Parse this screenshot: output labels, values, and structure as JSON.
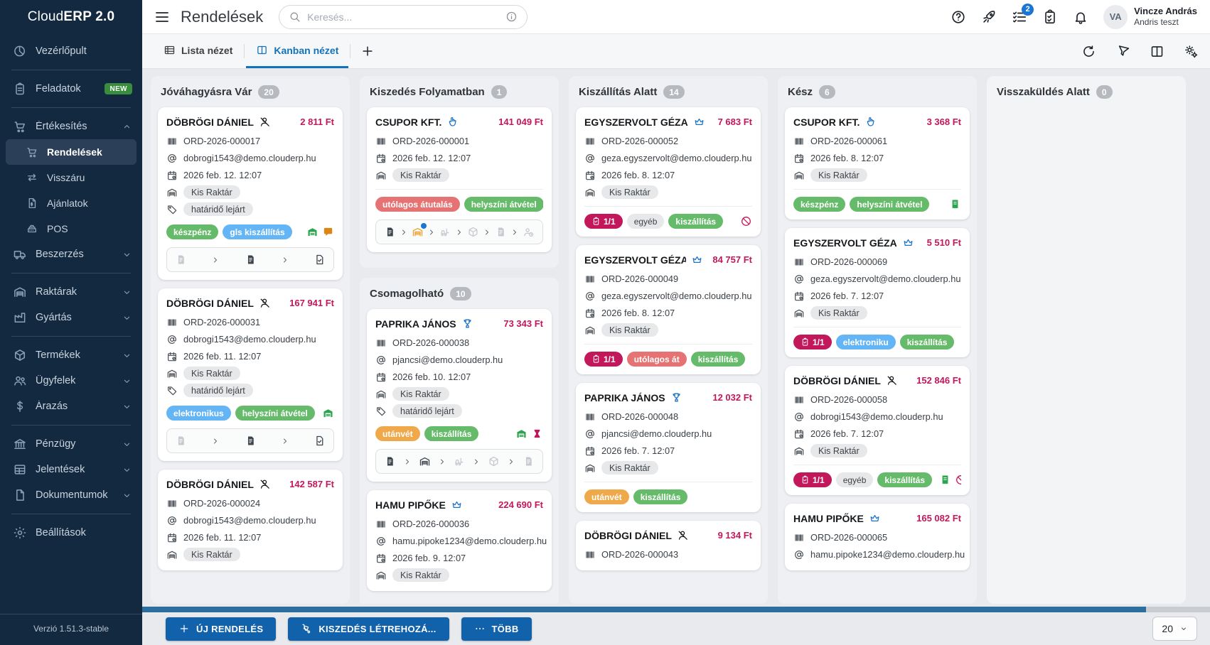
{
  "app": {
    "brand_light": "Cloud",
    "brand_bold": "ERP 2.0",
    "version": "Verzió 1.51.3-stable"
  },
  "sidebar": {
    "items": [
      {
        "type": "item",
        "icon": "dashboard",
        "label": "Vezérlőpult"
      },
      {
        "type": "divider"
      },
      {
        "type": "item",
        "icon": "tasks",
        "label": "Feladatok",
        "badge": "NEW"
      },
      {
        "type": "divider"
      },
      {
        "type": "item",
        "icon": "cart",
        "label": "Értékesítés",
        "chevron": "up"
      },
      {
        "type": "subitem",
        "icon": "cart",
        "label": "Rendelések",
        "active": true
      },
      {
        "type": "subitem",
        "icon": "swap",
        "label": "Visszáru"
      },
      {
        "type": "subitem",
        "icon": "quote",
        "label": "Ajánlatok"
      },
      {
        "type": "subitem",
        "icon": "register",
        "label": "POS"
      },
      {
        "type": "item",
        "icon": "truck",
        "label": "Beszerzés",
        "chevron": "down"
      },
      {
        "type": "divider"
      },
      {
        "type": "item",
        "icon": "warehouse",
        "label": "Raktárak",
        "chevron": "down"
      },
      {
        "type": "item",
        "icon": "factory",
        "label": "Gyártás",
        "chevron": "down"
      },
      {
        "type": "divider"
      },
      {
        "type": "item",
        "icon": "products",
        "label": "Termékek",
        "chevron": "down"
      },
      {
        "type": "item",
        "icon": "customers",
        "label": "Ügyfelek",
        "chevron": "down"
      },
      {
        "type": "item",
        "icon": "pricing",
        "label": "Árazás",
        "chevron": "down"
      },
      {
        "type": "divider"
      },
      {
        "type": "item",
        "icon": "finance",
        "label": "Pénzügy",
        "chevron": "down"
      },
      {
        "type": "item",
        "icon": "reports",
        "label": "Jelentések",
        "chevron": "down"
      },
      {
        "type": "item",
        "icon": "documents",
        "label": "Dokumentumok",
        "chevron": "down"
      },
      {
        "type": "divider"
      },
      {
        "type": "item",
        "icon": "settings",
        "label": "Beállítások"
      }
    ]
  },
  "header": {
    "title": "Rendelések",
    "search_placeholder": "Keresés...",
    "notification_count": "2",
    "user": {
      "initials": "VA",
      "name": "Vincze András",
      "subtitle": "Andris teszt"
    }
  },
  "tabs": {
    "list_label": "Lista nézet",
    "kanban_label": "Kanban nézet"
  },
  "board": {
    "tracks": [
      {
        "fill": true,
        "groups": [
          {
            "title": "Jóváhagyásra Vár",
            "count": "20",
            "cards": [
              {
                "customer": "DÖBRÖGI DÁNIEL",
                "icon": "person-off",
                "icon_color": "dark",
                "price": "2 811 Ft",
                "order": "ORD-2026-000017",
                "email": "dobrogi1543@demo.clouderp.hu",
                "date": "2026 feb. 12. 12:07",
                "warehouse": "Kis Raktár",
                "tag": "határidő lejárt",
                "chips": [
                  {
                    "label": "készpénz",
                    "style": "green"
                  },
                  {
                    "label": "gls kiszállítás",
                    "style": "blue"
                  }
                ],
                "trail": [
                  "warehouse-filled",
                  "chat"
                ],
                "progress": [
                  {
                    "icon": "note",
                    "state": "muted"
                  },
                  {
                    "icon": "note",
                    "state": "dark"
                  },
                  {
                    "icon": "file-check",
                    "state": "dark"
                  }
                ]
              },
              {
                "customer": "DÖBRÖGI DÁNIEL",
                "icon": "person-off",
                "icon_color": "dark",
                "price": "167 941 Ft",
                "order": "ORD-2026-000031",
                "email": "dobrogi1543@demo.clouderp.hu",
                "date": "2026 feb. 11. 12:07",
                "warehouse": "Kis Raktár",
                "tag": "határidő lejárt",
                "chips": [
                  {
                    "label": "elektronikus",
                    "style": "blue"
                  },
                  {
                    "label": "helyszíni átvétel",
                    "style": "green"
                  }
                ],
                "trail": [
                  "warehouse-filled"
                ],
                "progress": [
                  {
                    "icon": "note",
                    "state": "muted"
                  },
                  {
                    "icon": "note",
                    "state": "dark"
                  },
                  {
                    "icon": "file-check",
                    "state": "dark"
                  }
                ]
              },
              {
                "customer": "DÖBRÖGI DÁNIEL",
                "icon": "person-off",
                "icon_color": "dark",
                "price": "142 587 Ft",
                "order": "ORD-2026-000024",
                "email": "dobrogi1543@demo.clouderp.hu",
                "date": "2026 feb. 11. 12:07",
                "warehouse": "Kis Raktár"
              }
            ]
          }
        ]
      },
      {
        "fill": false,
        "groups": [
          {
            "title": "Kiszedés Folyamatban",
            "count": "1",
            "cards": [
              {
                "customer": "CSUPOR KFT.",
                "icon": "pointer",
                "icon_color": "blue",
                "price": "141 049 Ft",
                "order": "ORD-2026-000001",
                "date": "2026 feb. 12. 12:07",
                "warehouse": "Kis Raktár",
                "divider": true,
                "chips": [
                  {
                    "label": "utólagos átutalás",
                    "style": "red"
                  },
                  {
                    "label": "helyszíni átvétel",
                    "style": "green"
                  }
                ],
                "trail": [
                  "warehouse-filled",
                  "hourglass"
                ],
                "progress": [
                  {
                    "icon": "note",
                    "state": "dark"
                  },
                  {
                    "icon": "warehouse",
                    "state": "orange",
                    "dot": true
                  },
                  {
                    "icon": "forklift",
                    "state": "muted"
                  },
                  {
                    "icon": "box",
                    "state": "muted"
                  },
                  {
                    "icon": "note",
                    "state": "muted"
                  },
                  {
                    "icon": "person-clock",
                    "state": "muted"
                  }
                ]
              }
            ]
          },
          {
            "title": "Csomagolható",
            "count": "10",
            "cards": [
              {
                "customer": "PAPRIKA JÁNOS",
                "icon": "trophy",
                "icon_color": "blue",
                "price": "73 343 Ft",
                "order": "ORD-2026-000038",
                "email": "pjancsi@demo.clouderp.hu",
                "date": "2026 feb. 10. 12:07",
                "warehouse": "Kis Raktár",
                "tag": "határidő lejárt",
                "chips": [
                  {
                    "label": "utánvét",
                    "style": "orange"
                  },
                  {
                    "label": "kiszállítás",
                    "style": "green"
                  }
                ],
                "trail": [
                  "warehouse-filled",
                  "hourglass"
                ],
                "progress": [
                  {
                    "icon": "note",
                    "state": "dark"
                  },
                  {
                    "icon": "warehouse",
                    "state": "dark"
                  },
                  {
                    "icon": "forklift",
                    "state": "muted"
                  },
                  {
                    "icon": "box",
                    "state": "muted"
                  },
                  {
                    "icon": "note",
                    "state": "muted"
                  }
                ]
              },
              {
                "customer": "HAMU PIPŐKE",
                "icon": "crown",
                "icon_color": "blue",
                "price": "224 690 Ft",
                "order": "ORD-2026-000036",
                "email": "hamu.pipoke1234@demo.clouderp.hu",
                "date": "2026 feb. 9. 12:07",
                "warehouse": "Kis Raktár"
              }
            ]
          }
        ]
      },
      {
        "fill": true,
        "groups": [
          {
            "title": "Kiszállítás Alatt",
            "count": "14",
            "cards": [
              {
                "customer": "EGYSZERVOLT GÉZA",
                "icon": "crown",
                "icon_color": "blue",
                "price": "7 683 Ft",
                "order": "ORD-2026-000052",
                "email": "geza.egyszervolt@demo.clouderp.hu",
                "date": "2026 feb. 8. 12:07",
                "warehouse": "Kis Raktár",
                "divider": true,
                "chips": [
                  {
                    "label": "1/1",
                    "style": "crimson",
                    "icon": "clip-mini"
                  },
                  {
                    "label": "egyéb",
                    "style": "gray"
                  },
                  {
                    "label": "kiszállítás",
                    "style": "green"
                  }
                ],
                "trail": [
                  "prohibited"
                ]
              },
              {
                "customer": "EGYSZERVOLT GÉZA",
                "icon": "crown",
                "icon_color": "blue",
                "price": "84 757 Ft",
                "order": "ORD-2026-000049",
                "email": "geza.egyszervolt@demo.clouderp.hu",
                "date": "2026 feb. 8. 12:07",
                "warehouse": "Kis Raktár",
                "divider": true,
                "chips": [
                  {
                    "label": "1/1",
                    "style": "crimson",
                    "icon": "clip-mini"
                  },
                  {
                    "label": "utólagos át",
                    "style": "red"
                  },
                  {
                    "label": "kiszállítás",
                    "style": "green"
                  }
                ],
                "trail": [
                  "prohibited"
                ]
              },
              {
                "customer": "PAPRIKA JÁNOS",
                "icon": "trophy",
                "icon_color": "blue",
                "price": "12 032 Ft",
                "order": "ORD-2026-000048",
                "email": "pjancsi@demo.clouderp.hu",
                "date": "2026 feb. 7. 12:07",
                "warehouse": "Kis Raktár",
                "divider": true,
                "chips": [
                  {
                    "label": "utánvét",
                    "style": "orange"
                  },
                  {
                    "label": "kiszállítás",
                    "style": "green"
                  }
                ],
                "trail": []
              },
              {
                "customer": "DÖBRÖGI DÁNIEL",
                "icon": "person-off",
                "icon_color": "dark",
                "price": "9 134 Ft",
                "order": "ORD-2026-000043"
              }
            ]
          }
        ]
      },
      {
        "fill": true,
        "groups": [
          {
            "title": "Kész",
            "count": "6",
            "cards": [
              {
                "customer": "CSUPOR KFT.",
                "icon": "pointer",
                "icon_color": "blue",
                "price": "3 368 Ft",
                "order": "ORD-2026-000061",
                "date": "2026 feb. 8. 12:07",
                "warehouse": "Kis Raktár",
                "divider": true,
                "chips": [
                  {
                    "label": "készpénz",
                    "style": "green"
                  },
                  {
                    "label": "helyszíni átvétel",
                    "style": "green"
                  }
                ],
                "trail": [
                  "receipt"
                ]
              },
              {
                "customer": "EGYSZERVOLT GÉZA",
                "icon": "crown",
                "icon_color": "blue",
                "price": "5 510 Ft",
                "order": "ORD-2026-000069",
                "email": "geza.egyszervolt@demo.clouderp.hu",
                "date": "2026 feb. 7. 12:07",
                "warehouse": "Kis Raktár",
                "divider": true,
                "chips": [
                  {
                    "label": "1/1",
                    "style": "crimson",
                    "icon": "clip-mini"
                  },
                  {
                    "label": "elektroniku",
                    "style": "blue"
                  },
                  {
                    "label": "kiszállítás",
                    "style": "green"
                  }
                ],
                "trail": [
                  "receipt",
                  "prohibited"
                ]
              },
              {
                "customer": "DÖBRÖGI DÁNIEL",
                "icon": "person-off",
                "icon_color": "dark",
                "price": "152 846 Ft",
                "order": "ORD-2026-000058",
                "email": "dobrogi1543@demo.clouderp.hu",
                "date": "2026 feb. 7. 12:07",
                "warehouse": "Kis Raktár",
                "divider": true,
                "chips": [
                  {
                    "label": "1/1",
                    "style": "crimson",
                    "icon": "clip-mini"
                  },
                  {
                    "label": "egyéb",
                    "style": "gray"
                  },
                  {
                    "label": "kiszállítás",
                    "style": "green"
                  }
                ],
                "trail": [
                  "receipt",
                  "prohibited"
                ]
              },
              {
                "customer": "HAMU PIPŐKE",
                "icon": "crown",
                "icon_color": "blue",
                "price": "165 082 Ft",
                "order": "ORD-2026-000065",
                "email": "hamu.pipoke1234@demo.clouderp.hu"
              }
            ]
          }
        ]
      },
      {
        "fill": true,
        "groups": [
          {
            "title": "Visszaküldés Alatt",
            "count": "0",
            "cards": []
          }
        ]
      }
    ]
  },
  "footer": {
    "new_order_label": "ÚJ RENDELÉS",
    "create_picking_label": "KISZEDÉS LÉTREHOZÁ...",
    "more_label": "TÖBB",
    "page_size": "20"
  }
}
